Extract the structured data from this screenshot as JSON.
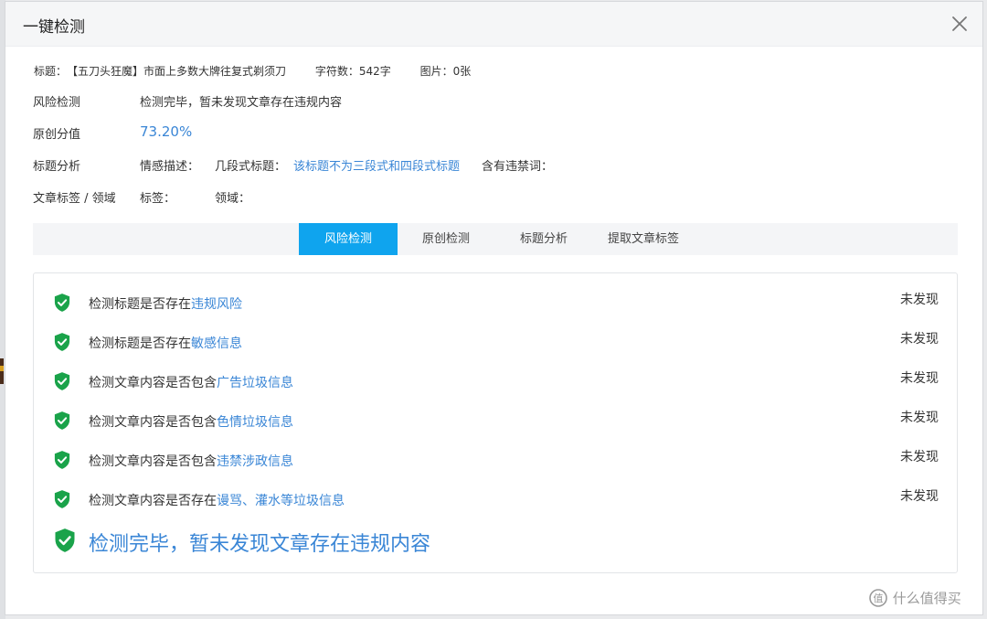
{
  "dialog": {
    "title": "一键检测"
  },
  "meta": {
    "title_label": "标题：",
    "title_value": "【五刀头狂魔】市面上多数大牌往复式剃须刀",
    "chars_label": "字符数：",
    "chars_value": "542字",
    "images_label": "图片：",
    "images_value": "0张"
  },
  "risk": {
    "label": "风险检测",
    "value": "检测完毕，暂未发现文章存在违规内容"
  },
  "original": {
    "label": "原创分值",
    "value": "73.20%"
  },
  "title_analysis": {
    "label": "标题分析",
    "emotion_label": "情感描述：",
    "segment_label": "几段式标题：",
    "segment_value": "该标题不为三段式和四段式标题",
    "banned_label": "含有违禁词："
  },
  "tags": {
    "label": "文章标签 / 领域",
    "tags_label": "标签：",
    "domain_label": "领域："
  },
  "tabs": [
    {
      "label": "风险检测",
      "active": true
    },
    {
      "label": "原创检测",
      "active": false
    },
    {
      "label": "标题分析",
      "active": false
    },
    {
      "label": "提取文章标签",
      "active": false
    }
  ],
  "checks": [
    {
      "prefix": "检测标题是否存在",
      "highlight": "违规风险",
      "status": "未发现"
    },
    {
      "prefix": "检测标题是否存在",
      "highlight": "敏感信息",
      "status": "未发现"
    },
    {
      "prefix": "检测文章内容是否包含",
      "highlight": "广告垃圾信息",
      "status": "未发现"
    },
    {
      "prefix": "检测文章内容是否包含",
      "highlight": "色情垃圾信息",
      "status": "未发现"
    },
    {
      "prefix": "检测文章内容是否包含",
      "highlight": "违禁涉政信息",
      "status": "未发现"
    },
    {
      "prefix": "检测文章内容是否存在",
      "highlight": "谩骂、灌水等垃圾信息",
      "status": "未发现"
    }
  ],
  "summary": "检测完毕，暂未发现文章存在违规内容",
  "watermark": "什么值得买",
  "colors": {
    "accent": "#0fa4ee",
    "link": "#3a86d6",
    "shield": "#1aa34a"
  },
  "icons": {
    "close": "close-icon",
    "check": "shield-check-icon",
    "watermark": "watermark-logo-icon"
  }
}
